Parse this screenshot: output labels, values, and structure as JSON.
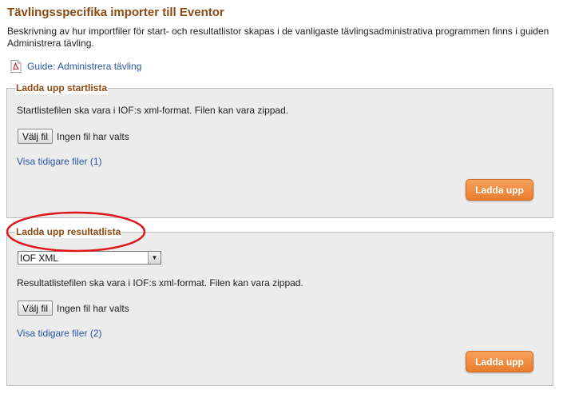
{
  "page": {
    "title": "Tävlingsspecifika importer till Eventor",
    "description": "Beskrivning av hur importfiler för start- och resultatlistor skapas i de vanligaste tävlingsadministrativa programmen finns i guiden Administrera tävling.",
    "guide_link": "Guide: Administrera tävling",
    "guide_icon": "pdf-icon"
  },
  "startlist": {
    "legend": "Ladda upp startlista",
    "info": "Startlistefilen ska vara i IOF:s xml-format. Filen kan vara zippad.",
    "file_button": "Välj fil",
    "file_status": "Ingen fil har valts",
    "previous_link": "Visa tidigare filer (1)",
    "upload_button": "Ladda upp"
  },
  "resultlist": {
    "legend": "Ladda upp resultatlista",
    "format_selected": "IOF XML",
    "info": "Resultatlistefilen ska vara i IOF:s xml-format. Filen kan vara zippad.",
    "file_button": "Välj fil",
    "file_status": "Ingen fil har valts",
    "previous_link": "Visa tidigare filer (2)",
    "upload_button": "Ladda upp"
  },
  "colors": {
    "heading": "#8b4a12",
    "link": "#2a55a8",
    "accent_button": "#ea7d2e",
    "annotation_circle": "#e0141b"
  }
}
